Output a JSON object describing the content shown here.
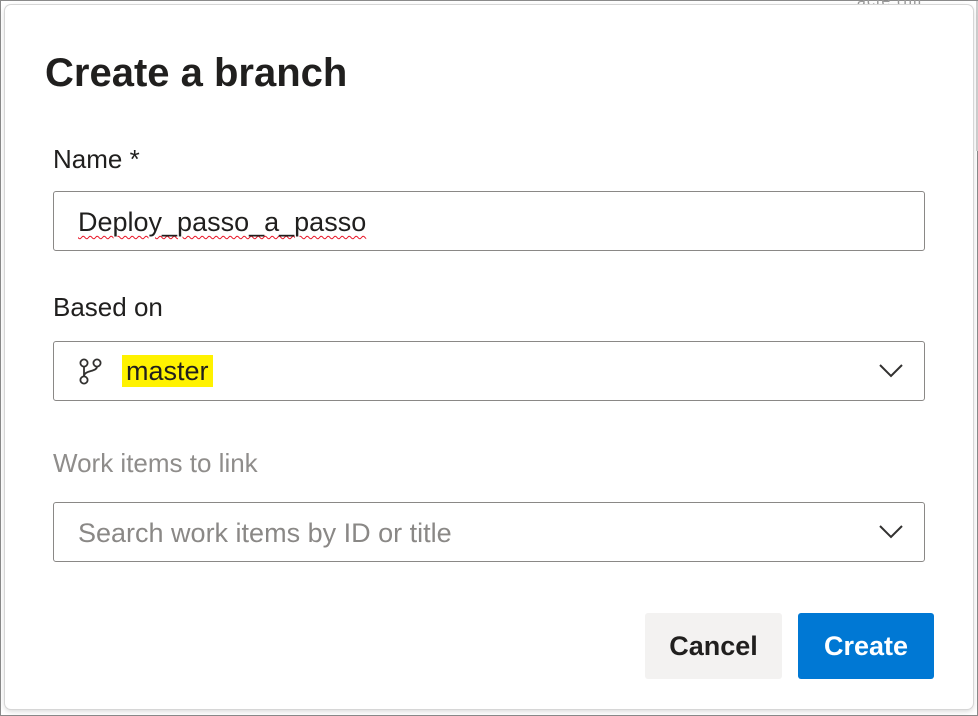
{
  "backdrop": {
    "fragment_text": "acte (fill"
  },
  "dialog": {
    "title": "Create a branch",
    "name_field": {
      "label": "Name *",
      "value": "Deploy_passo_a_passo"
    },
    "based_on_field": {
      "label": "Based on",
      "value": "master",
      "icon": "branch-icon",
      "highlight_color": "#fff200"
    },
    "work_items_field": {
      "label": "Work items to link",
      "placeholder": "Search work items by ID or title"
    },
    "buttons": {
      "cancel": "Cancel",
      "create": "Create"
    }
  },
  "colors": {
    "primary": "#0078d4",
    "secondary_button": "#f3f2f1",
    "text": "#201f1e",
    "disabled_text": "#8f8d8b",
    "spellcheck_underline": "#e81123"
  }
}
